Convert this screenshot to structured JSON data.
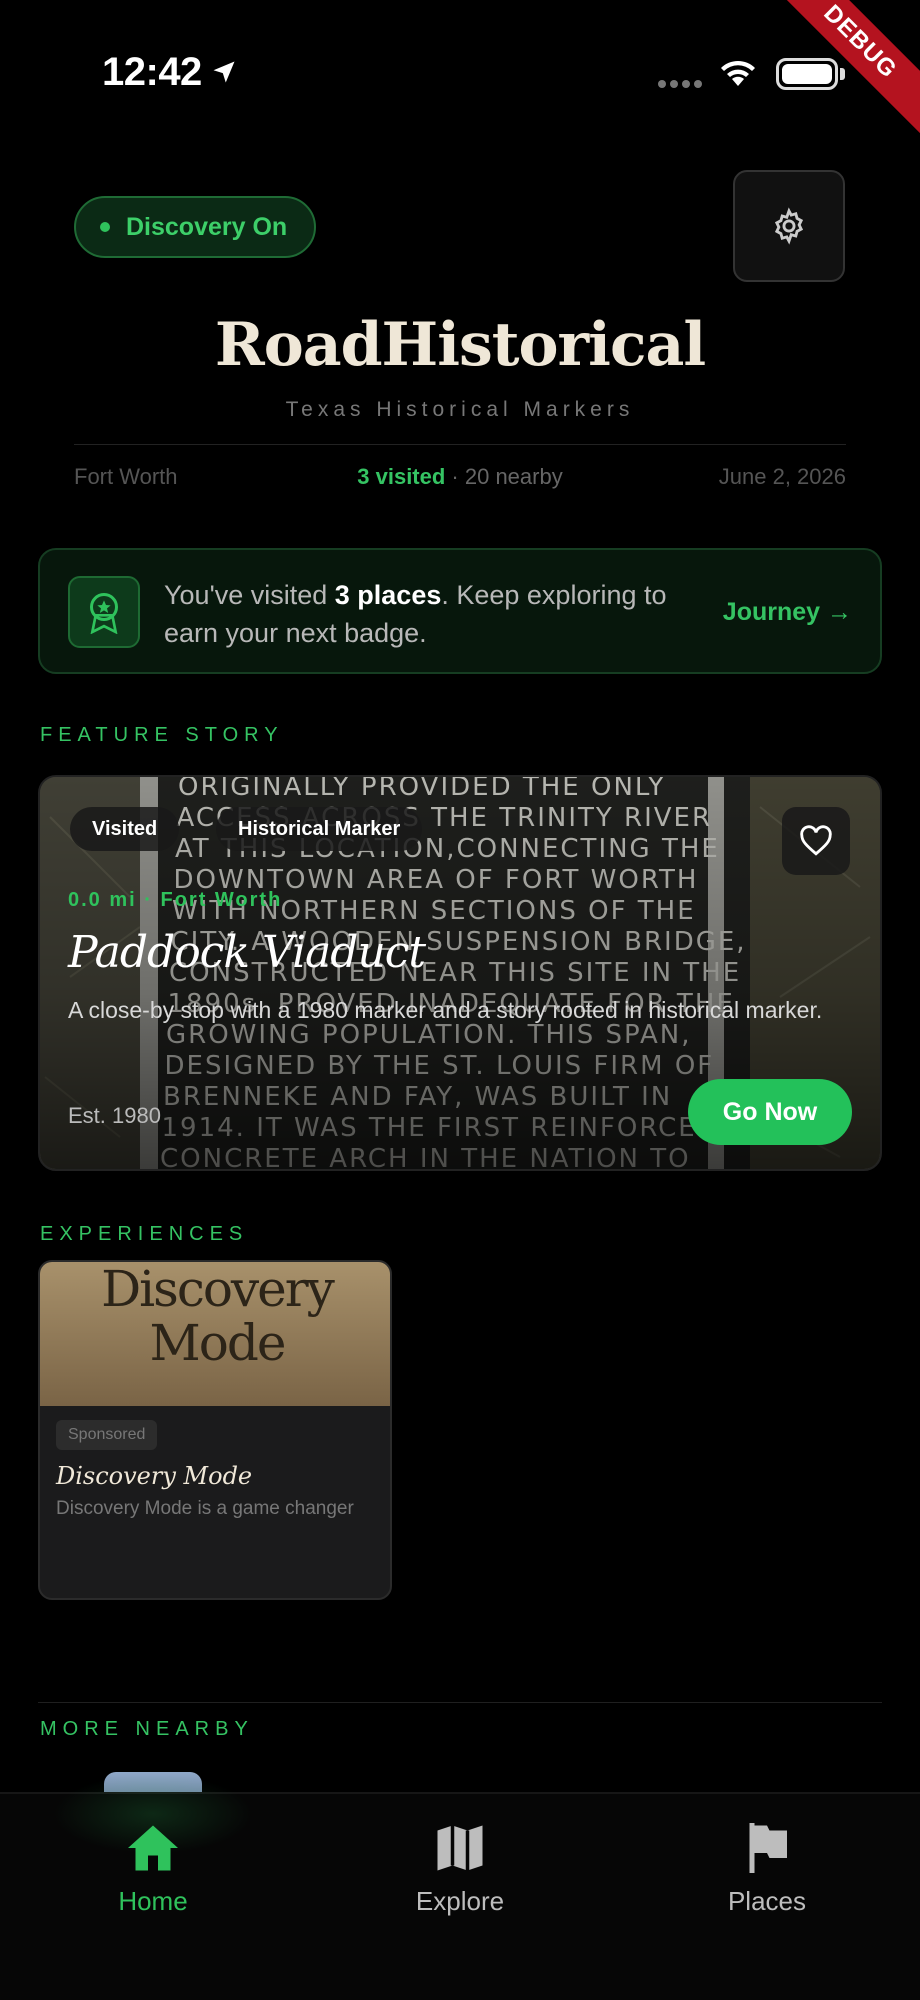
{
  "status_bar": {
    "time": "12:42"
  },
  "debug_ribbon": "DEBUG",
  "header": {
    "discovery_pill": "Discovery On",
    "title": "RoadHistorical",
    "subtitle": "Texas Historical Markers",
    "city": "Fort Worth",
    "visited": "3 visited",
    "nearby": " · 20 nearby",
    "date": "June 2, 2026"
  },
  "badge_banner": {
    "text_before": "You've visited ",
    "count": "3 places",
    "text_after": ". Keep exploring to earn your next badge.",
    "link": "Journey →"
  },
  "feature_section": {
    "label": "FEATURE STORY",
    "chips": [
      "Visited",
      "Historical Marker"
    ],
    "meta": "0.0 mi · Fort Worth",
    "title": "Paddock Viaduct",
    "description": "A close-by stop with a 1980 marker and a story rooted in historical marker.",
    "established": "Est. 1980",
    "cta": "Go Now",
    "marker_lines": [
      "ORIGINALLY PROVIDED THE ONLY",
      "ACCESS ACROSS THE TRINITY RIVER",
      "AT THIS LOCATION,CONNECTING THE",
      "DOWNTOWN AREA OF FORT WORTH",
      "WITH NORTHERN SECTIONS OF THE",
      "CITY. A WOODEN SUSPENSION BRIDGE,",
      "CONSTRUCTED NEAR THIS SITE IN THE",
      "1890s, PROVED INADEQUATE FOR THE",
      "GROWING POPULATION. THIS SPAN,",
      "DESIGNED BY THE ST. LOUIS FIRM OF",
      "BRENNEKE AND FAY, WAS BUILT IN",
      "1914. IT WAS THE FIRST REINFORCED",
      "CONCRETE ARCH IN THE NATION TO"
    ]
  },
  "experiences_section": {
    "label": "EXPERIENCES",
    "cards": [
      {
        "image_text_line1": "Discovery",
        "image_text_line2": "Mode",
        "badge": "Sponsored",
        "title": "Discovery Mode",
        "description": "Discovery Mode is a game changer"
      }
    ]
  },
  "more_section": {
    "label": "MORE NEARBY"
  },
  "bottom_nav": {
    "items": [
      {
        "label": "Home",
        "icon": "home-icon",
        "active": true
      },
      {
        "label": "Explore",
        "icon": "map-icon",
        "active": false
      },
      {
        "label": "Places",
        "icon": "flag-icon",
        "active": false
      }
    ]
  },
  "colors": {
    "accent": "#2fc25c",
    "background": "#000000",
    "title": "#efe7d7"
  }
}
